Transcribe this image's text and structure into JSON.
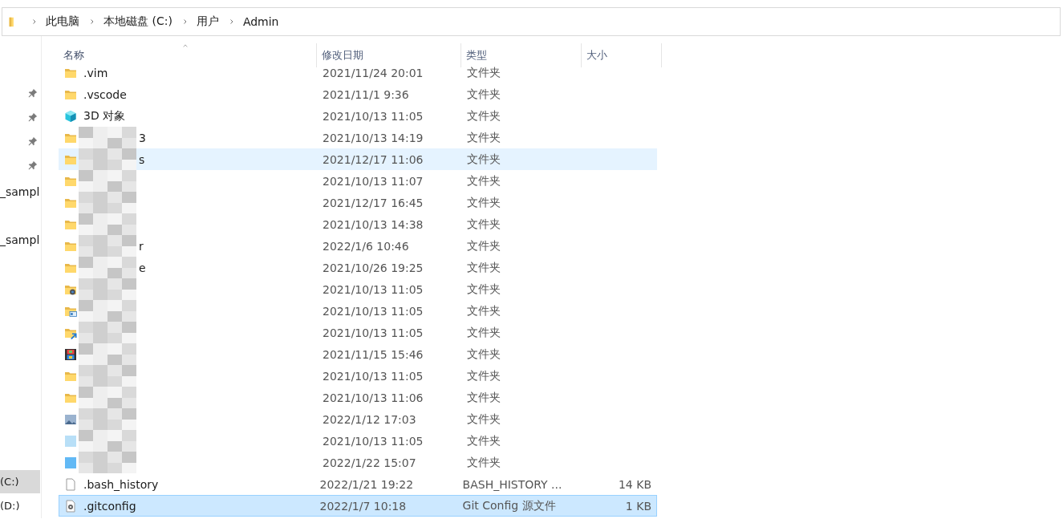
{
  "address_bar": {
    "crumbs": [
      "此电脑",
      "本地磁盘 (C:)",
      "用户",
      "Admin"
    ]
  },
  "nav_pane": {
    "pinned": [
      {
        "kind": "pin"
      },
      {
        "kind": "pin"
      },
      {
        "kind": "pin"
      },
      {
        "kind": "pin"
      },
      {
        "kind": "text",
        "label": "_sampl"
      },
      {
        "kind": "text",
        "label": "_sampl"
      }
    ],
    "drives": [
      {
        "label": "(C:)",
        "selected": true
      },
      {
        "label": "(D:)",
        "selected": false
      }
    ]
  },
  "columns": [
    {
      "label": "名称",
      "sorted": true
    },
    {
      "label": "修改日期",
      "sorted": false
    },
    {
      "label": "类型",
      "sorted": false
    },
    {
      "label": "大小",
      "sorted": false
    }
  ],
  "rows": [
    {
      "kind": "folder",
      "name": ".vim",
      "date": "2021/11/24 20:01",
      "type": "文件夹",
      "obscured": false,
      "hovered": false,
      "selected": false
    },
    {
      "kind": "folder",
      "name": ".vscode",
      "date": "2021/11/1 9:36",
      "type": "文件夹",
      "obscured": false,
      "hovered": false,
      "selected": false
    },
    {
      "kind": "cube",
      "name": "3D 对象",
      "date": "2021/10/13 11:05",
      "type": "文件夹",
      "obscured": false,
      "hovered": false,
      "selected": false
    },
    {
      "kind": "folder",
      "name": "3",
      "date": "2021/10/13 14:19",
      "type": "文件夹",
      "obscured": true,
      "hovered": false,
      "selected": false
    },
    {
      "kind": "folder",
      "name": "s",
      "date": "2021/12/17 11:06",
      "type": "文件夹",
      "obscured": true,
      "hovered": true,
      "selected": false
    },
    {
      "kind": "folder",
      "date": "2021/10/13 11:07",
      "type": "文件夹",
      "obscured": true,
      "hovered": false,
      "selected": false
    },
    {
      "kind": "folder",
      "date": "2021/12/17 16:45",
      "type": "文件夹",
      "obscured": true,
      "hovered": false,
      "selected": false
    },
    {
      "kind": "folder",
      "date": "2021/10/13 14:38",
      "type": "文件夹",
      "obscured": true,
      "hovered": false,
      "selected": false
    },
    {
      "kind": "folder",
      "name": "r",
      "date": "2022/1/6 10:46",
      "type": "文件夹",
      "obscured": true,
      "hovered": false,
      "selected": false
    },
    {
      "kind": "folder",
      "name": "e",
      "date": "2021/10/26 19:25",
      "type": "文件夹",
      "obscured": true,
      "hovered": false,
      "selected": false
    },
    {
      "kind": "folder-gear",
      "date": "2021/10/13 11:05",
      "type": "文件夹",
      "obscured": true,
      "hovered": false,
      "selected": false
    },
    {
      "kind": "folder-card",
      "date": "2021/10/13 11:05",
      "type": "文件夹",
      "obscured": true,
      "hovered": false,
      "selected": false
    },
    {
      "kind": "folder-arrow",
      "date": "2021/10/13 11:05",
      "type": "文件夹",
      "obscured": true,
      "hovered": false,
      "selected": false
    },
    {
      "kind": "film",
      "date": "2021/11/15 15:46",
      "type": "文件夹",
      "obscured": true,
      "hovered": false,
      "selected": false
    },
    {
      "kind": "folder",
      "date": "2021/10/13 11:05",
      "type": "文件夹",
      "obscured": true,
      "hovered": false,
      "selected": false
    },
    {
      "kind": "folder",
      "date": "2021/10/13 11:06",
      "type": "文件夹",
      "obscured": true,
      "hovered": false,
      "selected": false
    },
    {
      "kind": "image",
      "date": "2022/1/12 17:03",
      "type": "文件夹",
      "obscured": true,
      "hovered": false,
      "selected": false
    },
    {
      "kind": "pale-tile",
      "date": "2021/10/13 11:05",
      "type": "文件夹",
      "obscured": true,
      "hovered": false,
      "selected": false
    },
    {
      "kind": "blue-tile",
      "date": "2022/1/22 15:07",
      "type": "文件夹",
      "obscured": true,
      "hovered": false,
      "selected": false
    },
    {
      "kind": "file",
      "name": ".bash_history",
      "date": "2022/1/21 19:22",
      "type": "BASH_HISTORY ...",
      "size": "14 KB",
      "obscured": false,
      "hovered": false,
      "selected": false
    },
    {
      "kind": "gear-file",
      "name": ".gitconfig",
      "date": "2022/1/7 10:18",
      "type": "Git Config 源文件",
      "size": "1 KB",
      "obscured": false,
      "hovered": false,
      "selected": true
    }
  ]
}
